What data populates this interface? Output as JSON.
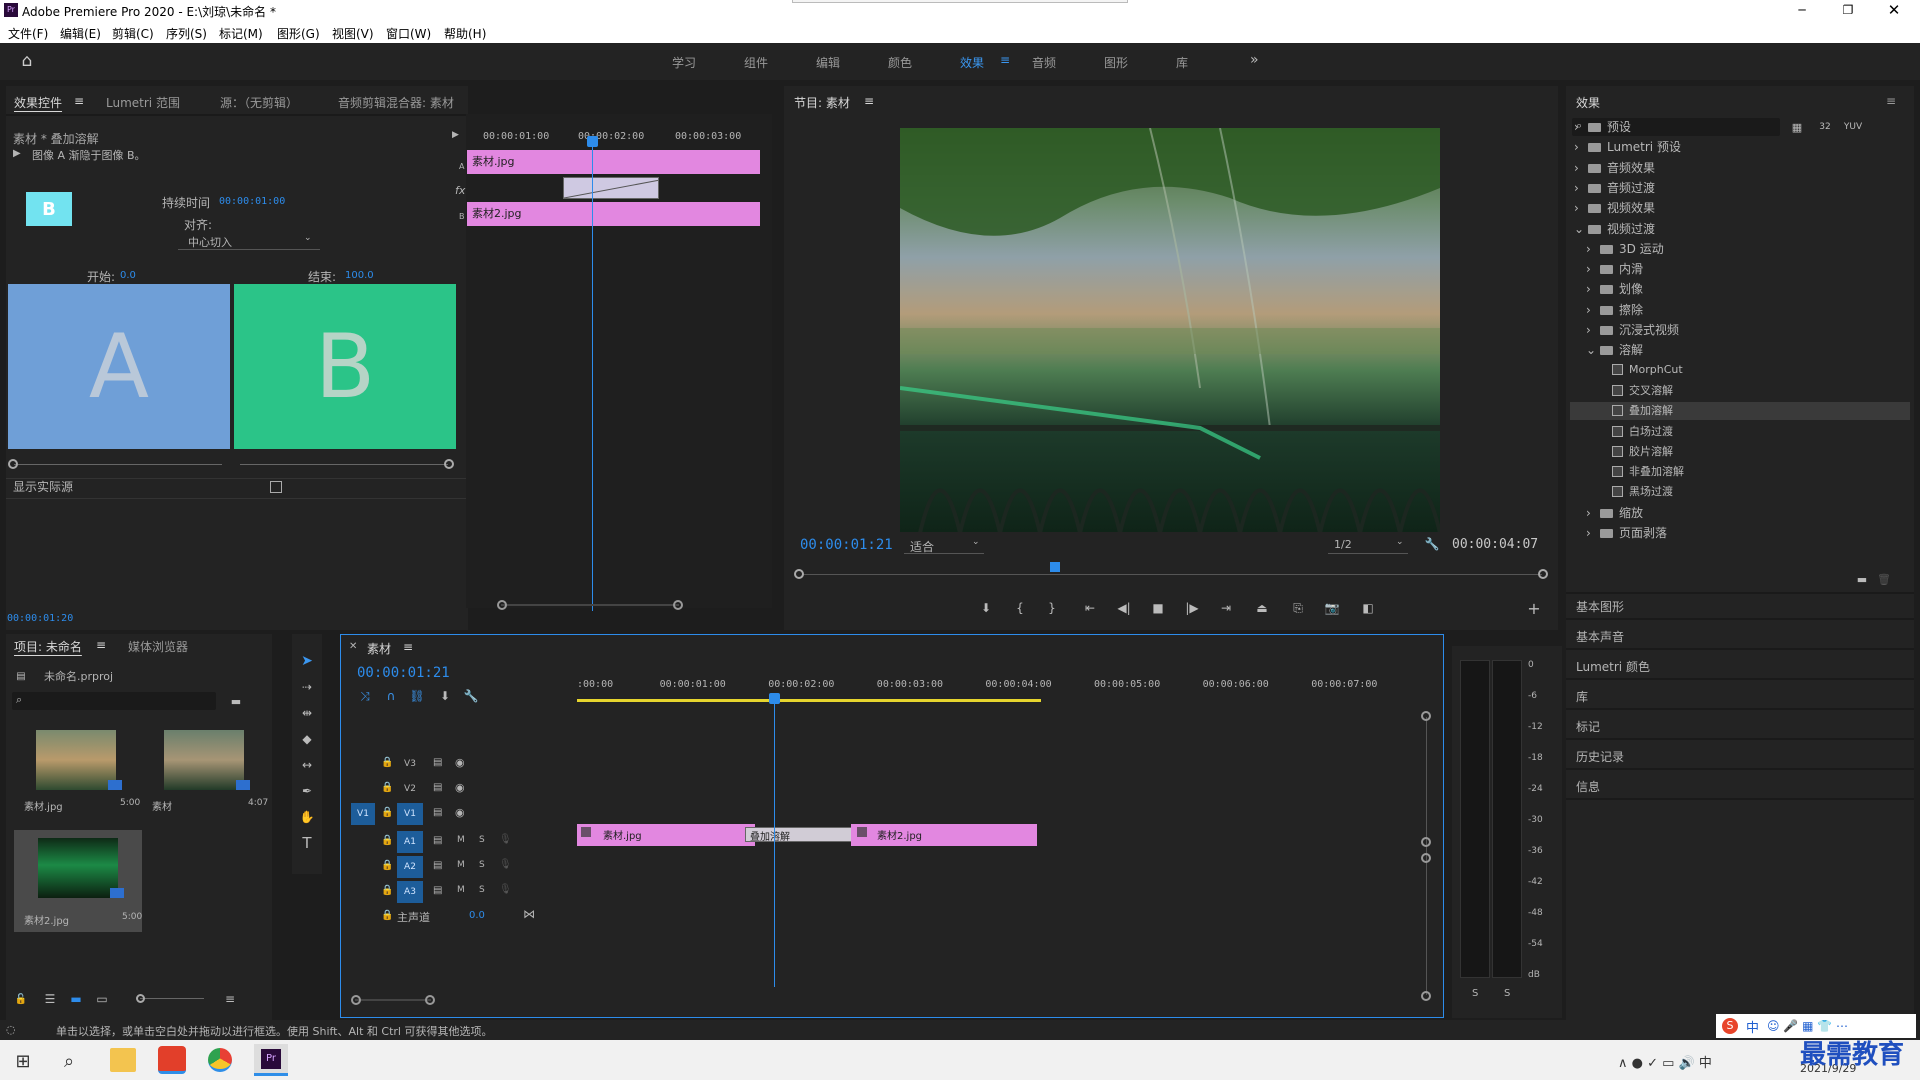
{
  "app": {
    "title": "Adobe Premiere Pro 2020 - E:\\刘琼\\未命名 *",
    "logo": "Pr"
  },
  "menu": [
    "文件(F)",
    "编辑(E)",
    "剪辑(C)",
    "序列(S)",
    "标记(M)",
    "图形(G)",
    "视图(V)",
    "窗口(W)",
    "帮助(H)"
  ],
  "workspaces": [
    "学习",
    "组件",
    "编辑",
    "颜色",
    "效果",
    "音频",
    "图形",
    "库"
  ],
  "active_workspace": "效果",
  "effect_controls": {
    "tabs": [
      "效果控件",
      "Lumetri 范围",
      "源：（无剪辑）",
      "音频剪辑混合器: 素材"
    ],
    "header": "素材 * 叠加溶解",
    "description": "图像 A 渐隐于图像 B。",
    "thumb_letter": "B",
    "duration_label": "持续时间",
    "duration_value": "00:00:01:00",
    "align_label": "对齐:",
    "align_value": "中心切入",
    "start_label": "开始:",
    "start_value": "0.0",
    "end_label": "结束:",
    "end_value": "100.0",
    "preview_a": "A",
    "preview_b": "B",
    "show_actual": "显示实际源",
    "timecode": "00:00:01:20",
    "mini_ruler": [
      "00:00:01:00",
      "00:00:02:00",
      "00:00:03:00"
    ],
    "clip_a": "素材.jpg",
    "clip_b": "素材2.jpg",
    "track_a": "A",
    "track_b": "B",
    "fx_label": "fx"
  },
  "program": {
    "title": "节目: 素材",
    "timecode": "00:00:01:21",
    "fit": "适合",
    "resolution": "1/2",
    "duration": "00:00:04:07"
  },
  "effects_panel": {
    "title": "效果",
    "tree": [
      {
        "label": "预设",
        "level": 0,
        "kind": "bin",
        "open": false
      },
      {
        "label": "Lumetri 预设",
        "level": 0,
        "kind": "bin",
        "open": false
      },
      {
        "label": "音频效果",
        "level": 0,
        "kind": "folder",
        "open": false
      },
      {
        "label": "音频过渡",
        "level": 0,
        "kind": "folder",
        "open": false
      },
      {
        "label": "视频效果",
        "level": 0,
        "kind": "folder",
        "open": false
      },
      {
        "label": "视频过渡",
        "level": 0,
        "kind": "folder",
        "open": true
      },
      {
        "label": "3D 运动",
        "level": 1,
        "kind": "folder",
        "open": false
      },
      {
        "label": "内滑",
        "level": 1,
        "kind": "folder",
        "open": false
      },
      {
        "label": "划像",
        "level": 1,
        "kind": "folder",
        "open": false
      },
      {
        "label": "擦除",
        "level": 1,
        "kind": "folder",
        "open": false
      },
      {
        "label": "沉浸式视频",
        "level": 1,
        "kind": "folder",
        "open": false
      },
      {
        "label": "溶解",
        "level": 1,
        "kind": "folder",
        "open": true
      },
      {
        "label": "MorphCut",
        "level": 2,
        "kind": "fx"
      },
      {
        "label": "交叉溶解",
        "level": 2,
        "kind": "fx"
      },
      {
        "label": "叠加溶解",
        "level": 2,
        "kind": "fx",
        "selected": true
      },
      {
        "label": "白场过渡",
        "level": 2,
        "kind": "fx"
      },
      {
        "label": "胶片溶解",
        "level": 2,
        "kind": "fx"
      },
      {
        "label": "非叠加溶解",
        "level": 2,
        "kind": "fx"
      },
      {
        "label": "黑场过渡",
        "level": 2,
        "kind": "fx"
      },
      {
        "label": "缩放",
        "level": 1,
        "kind": "folder",
        "open": false
      },
      {
        "label": "页面剥落",
        "level": 1,
        "kind": "folder",
        "open": false
      }
    ],
    "sections": [
      "基本图形",
      "基本声音",
      "Lumetri 颜色",
      "库",
      "标记",
      "历史记录",
      "信息"
    ]
  },
  "project": {
    "tabs": [
      "项目: 未命名",
      "媒体浏览器"
    ],
    "file": "未命名.prproj",
    "items": [
      {
        "name": "素材.jpg",
        "dur": "5:00"
      },
      {
        "name": "素材",
        "dur": "4:07"
      },
      {
        "name": "素材2.jpg",
        "dur": "5:00"
      }
    ]
  },
  "timeline": {
    "tab": "素材",
    "timecode": "00:00:01:21",
    "ruler": [
      ":00:00",
      "00:00:01:00",
      "00:00:02:00",
      "00:00:03:00",
      "00:00:04:00",
      "00:00:05:00",
      "00:00:06:00",
      "00:00:07:00"
    ],
    "tracks": [
      {
        "id": "V3",
        "src": ""
      },
      {
        "id": "V2",
        "src": ""
      },
      {
        "id": "V1",
        "src": "V1"
      },
      {
        "id": "A1",
        "src": ""
      },
      {
        "id": "A2",
        "src": ""
      },
      {
        "id": "A3",
        "src": ""
      }
    ],
    "m": "M",
    "s": "S",
    "master": "主声道",
    "master_val": "0.0",
    "clip1": "素材.jpg",
    "transition": "叠加溶解",
    "clip2": "素材2.jpg"
  },
  "meter": {
    "scale": [
      "0",
      "-6",
      "-12",
      "-18",
      "-24",
      "-30",
      "-36",
      "-42",
      "-48",
      "-54",
      "dB"
    ],
    "solo": [
      "S",
      "S"
    ]
  },
  "status": "单击以选择，或单击空白处并拖动以进行框选。使用 Shift、Alt 和 Ctrl 可获得其他选项。",
  "taskbar": {
    "date": "2021/9/29",
    "watermark": "最需教育"
  },
  "ime": "中"
}
